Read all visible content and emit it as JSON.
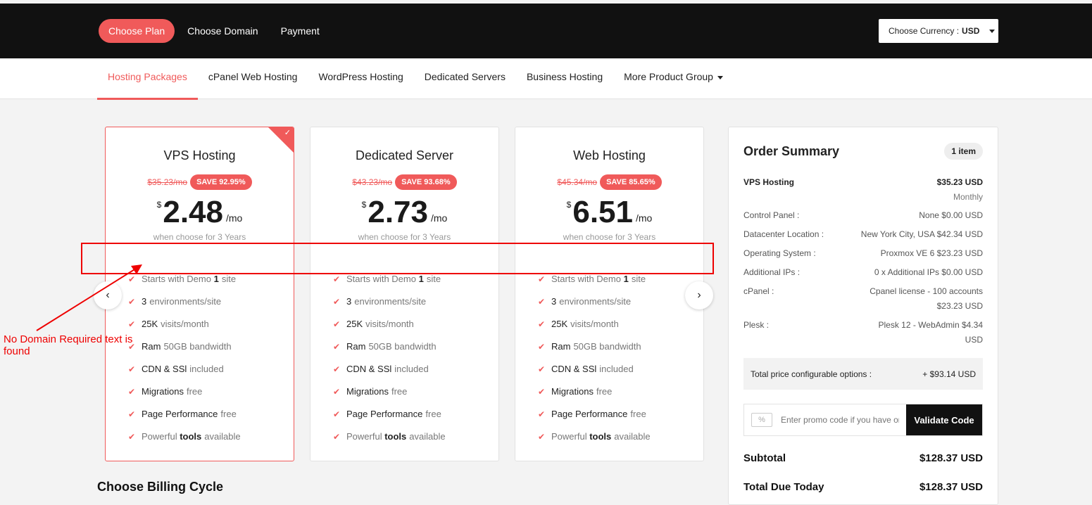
{
  "header": {
    "steps": [
      "Choose Plan",
      "Choose Domain",
      "Payment"
    ],
    "currency_label": "Choose Currency :",
    "currency_value": "USD"
  },
  "tabs": [
    "Hosting Packages",
    "cPanel Web Hosting",
    "WordPress Hosting",
    "Dedicated Servers",
    "Business Hosting",
    "More Product Group"
  ],
  "cards": [
    {
      "name": "VPS Hosting",
      "old_price": "$35.23/mo",
      "save": "SAVE 92.95%",
      "currency": "$",
      "amount": "2.48",
      "per": "/mo",
      "when": "when choose for 3 Years"
    },
    {
      "name": "Dedicated Server",
      "old_price": "$43.23/mo",
      "save": "SAVE 93.68%",
      "currency": "$",
      "amount": "2.73",
      "per": "/mo",
      "when": "when choose for 3 Years"
    },
    {
      "name": "Web Hosting",
      "old_price": "$45.34/mo",
      "save": "SAVE 85.65%",
      "currency": "$",
      "amount": "6.51",
      "per": "/mo",
      "when": "when choose for 3 Years"
    }
  ],
  "features": [
    {
      "pre": "Starts with Demo",
      "bold": "1",
      "post": "site",
      "boldfirst": false
    },
    {
      "bold": "3",
      "post": "environments/site",
      "boldfirst": true
    },
    {
      "bold": "25K",
      "post": "visits/month",
      "boldfirst": true
    },
    {
      "bold": "Ram",
      "post": "50GB bandwidth",
      "boldfirst": true
    },
    {
      "bold": "CDN & SSl",
      "post": "included",
      "boldfirst": true
    },
    {
      "bold": "Migrations",
      "post": "free",
      "boldfirst": true
    },
    {
      "bold": "Page Performance",
      "post": "free",
      "boldfirst": true
    },
    {
      "pre": "Powerful",
      "bold": "tools",
      "post": "available",
      "boldfirst": false
    }
  ],
  "billing_title": "Choose Billing Cycle",
  "annotation": {
    "text": "No Domain Required text is found"
  },
  "summary": {
    "title": "Order Summary",
    "items_badge": "1 item",
    "product": "VPS Hosting",
    "product_price": "$35.23 USD",
    "product_cycle": "Monthly",
    "options": [
      {
        "label": "Control Panel :",
        "value": "None $0.00 USD"
      },
      {
        "label": "Datacenter Location :",
        "value": "New York City, USA $42.34 USD"
      },
      {
        "label": "Operating System :",
        "value": "Proxmox VE 6 $23.23 USD"
      },
      {
        "label": "Additional IPs :",
        "value": "0 x Additional IPs $0.00 USD"
      },
      {
        "label": "cPanel :",
        "value": "Cpanel license - 100 accounts $23.23 USD"
      },
      {
        "label": "Plesk :",
        "value": "Plesk 12 - WebAdmin $4.34 USD"
      }
    ],
    "total_options_label": "Total price configurable options :",
    "total_options_value": "+ $93.14 USD",
    "promo_placeholder": "Enter promo code if you have one",
    "validate_label": "Validate Code",
    "subtotal_label": "Subtotal",
    "subtotal_value": "$128.37 USD",
    "total_due_label": "Total Due Today",
    "total_due_value": "$128.37 USD"
  },
  "colors": {
    "accent": "#f05a5a",
    "header_bg": "#111111",
    "annotation": "#ee0000"
  }
}
